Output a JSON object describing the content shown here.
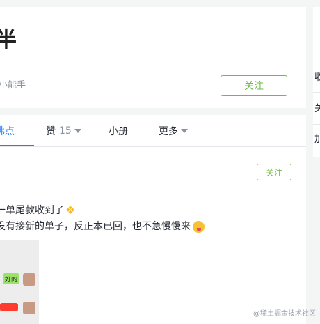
{
  "profile": {
    "name": "半",
    "role": "小能手",
    "follow_label": "关注"
  },
  "sidebar": {
    "items": [
      "收",
      "关",
      "加"
    ]
  },
  "tabs": [
    {
      "label": "沸点",
      "active": true
    },
    {
      "label": "赞",
      "count": "15"
    },
    {
      "label": "小册"
    },
    {
      "label": "更多"
    }
  ],
  "post": {
    "follow_label": "关注",
    "line1": "一单尾款收到了",
    "line2": "没有接新的单子，反正本已回，也不急慢慢来",
    "image_bubble_text": "好的"
  },
  "watermark": "@稀土掘金技术社区",
  "colors": {
    "accent": "#1e80ff",
    "follow_green": "#6cbd45",
    "page_bg": "#f4f5f5"
  }
}
